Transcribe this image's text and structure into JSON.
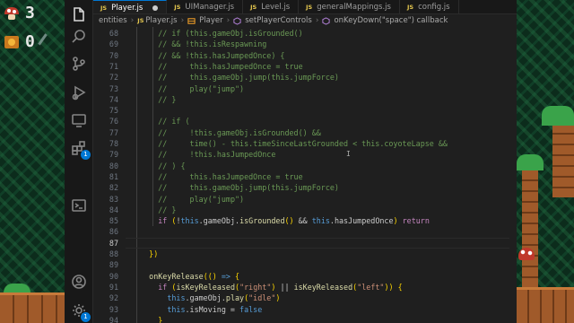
{
  "colors": {
    "editor_bg": "#1f1f1f",
    "accent": "#0078d4",
    "comment": "#6a9955",
    "keyword": "#c586c0",
    "this": "#569cd6",
    "function": "#dcdcaa",
    "string": "#ce9178",
    "js_badge": "#e6c84f"
  },
  "game_hud": {
    "lives_icon": "mushroom-icon",
    "lives": "3",
    "coins_icon": "coin-block-icon",
    "coins": "0"
  },
  "activity_bar": [
    {
      "name": "files-icon",
      "active": true
    },
    {
      "name": "search-icon"
    },
    {
      "name": "source-control-icon"
    },
    {
      "name": "run-debug-icon"
    },
    {
      "name": "remote-explorer-icon"
    },
    {
      "name": "extensions-icon",
      "badge": "1"
    },
    {
      "name": "terminal-icon"
    },
    {
      "name": "accounts-icon"
    },
    {
      "name": "manage-icon",
      "badge": "1"
    }
  ],
  "tabs": [
    {
      "badge": "JS",
      "label": "Player.js",
      "active": true,
      "dirty": true
    },
    {
      "badge": "JS",
      "label": "UIManager.js"
    },
    {
      "badge": "JS",
      "label": "Level.js"
    },
    {
      "badge": "JS",
      "label": "generalMappings.js"
    },
    {
      "badge": "JS",
      "label": "config.js"
    }
  ],
  "breadcrumbs": [
    {
      "label": "entities"
    },
    {
      "label": "Player.js",
      "badge": "JS"
    },
    {
      "label": "Player",
      "icon": "class-icon"
    },
    {
      "label": "setPlayerControls",
      "icon": "method-icon"
    },
    {
      "label": "onKeyDown(\"space\") callback",
      "icon": "method-icon"
    }
  ],
  "editor": {
    "current_line": "87",
    "lines": [
      {
        "n": "68",
        "code": "      // if (this.gameObj.isGrounded()"
      },
      {
        "n": "69",
        "code": "      // && !this.isRespawning"
      },
      {
        "n": "70",
        "code": "      // && !this.hasJumpedOnce) {"
      },
      {
        "n": "71",
        "code": "      //     this.hasJumpedOnce = true"
      },
      {
        "n": "72",
        "code": "      //     this.gameObj.jump(this.jumpForce)"
      },
      {
        "n": "73",
        "code": "      //     play(\"jump\")"
      },
      {
        "n": "74",
        "code": "      // }"
      },
      {
        "n": "75",
        "code": ""
      },
      {
        "n": "76",
        "code": "      // if ("
      },
      {
        "n": "77",
        "code": "      //     !this.gameObj.isGrounded() &&"
      },
      {
        "n": "78",
        "code": "      //     time() - this.timeSinceLastGrounded < this.coyoteLapse &&"
      },
      {
        "n": "79",
        "code": "      //     !this.hasJumpedOnce"
      },
      {
        "n": "80",
        "code": "      // ) {"
      },
      {
        "n": "81",
        "code": "      //     this.hasJumpedOnce = true"
      },
      {
        "n": "82",
        "code": "      //     this.gameObj.jump(this.jumpForce)"
      },
      {
        "n": "83",
        "code": "      //     play(\"jump\")"
      },
      {
        "n": "84",
        "code": "      // }"
      },
      {
        "n": "85",
        "code": "      if (!this.gameObj.isGrounded() && this.hasJumpedOnce) return"
      },
      {
        "n": "86",
        "code": ""
      },
      {
        "n": "87",
        "code": ""
      },
      {
        "n": "88",
        "code": "    })"
      },
      {
        "n": "89",
        "code": ""
      },
      {
        "n": "90",
        "code": "    onKeyRelease(() => {"
      },
      {
        "n": "91",
        "code": "      if (isKeyReleased(\"right\") || isKeyReleased(\"left\")) {"
      },
      {
        "n": "92",
        "code": "        this.gameObj.play(\"idle\")"
      },
      {
        "n": "93",
        "code": "        this.isMoving = false"
      },
      {
        "n": "94",
        "code": "      }"
      }
    ]
  }
}
